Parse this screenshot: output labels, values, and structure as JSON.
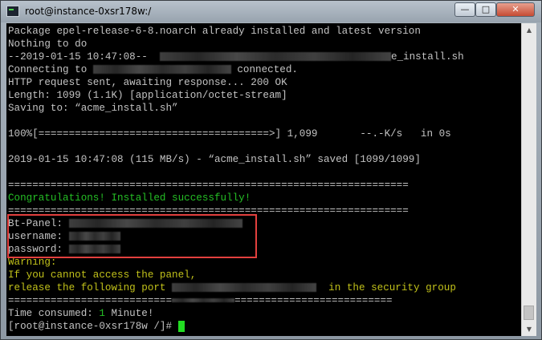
{
  "window": {
    "title": "root@instance-0xsr178w:/",
    "minimize": "—",
    "maximize": "□",
    "close": "✕",
    "icon": "terminal-icon"
  },
  "terminal": {
    "lines": [
      {
        "text": "Package epel-release-6-8.noarch already installed and latest version",
        "color": "#c3c3c3"
      },
      {
        "text": "Nothing to do",
        "color": "#c3c3c3"
      },
      {
        "pre": "--2019-01-15 10:47:08--  ",
        "post": "e_install.sh",
        "color": "#c3c3c3"
      },
      {
        "pre": "Connecting to ",
        "post": " connected.",
        "color": "#c3c3c3"
      },
      {
        "text": "HTTP request sent, awaiting response... 200 OK",
        "color": "#c3c3c3"
      },
      {
        "text": "Length: 1099 (1.1K) [application/octet-stream]",
        "color": "#c3c3c3"
      },
      {
        "text": "Saving to: “acme_install.sh”",
        "color": "#c3c3c3"
      },
      {
        "text": "",
        "color": "#c3c3c3"
      },
      {
        "text": "100%[======================================>] 1,099       --.-K/s   in 0s",
        "color": "#c3c3c3"
      },
      {
        "text": "",
        "color": "#c3c3c3"
      },
      {
        "text": "2019-01-15 10:47:08 (115 MB/s) - “acme_install.sh” saved [1099/1099]",
        "color": "#c3c3c3"
      },
      {
        "text": "",
        "color": "#c3c3c3"
      },
      {
        "text": "==================================================================",
        "color": "#c3c3c3"
      },
      {
        "text": "Congratulations! Installed successfully!",
        "color": "#25bf25"
      },
      {
        "text": "==================================================================",
        "color": "#c3c3c3"
      },
      {
        "pre": "Bt-Panel: ",
        "post": "",
        "color": "#c3c3c3"
      },
      {
        "pre": "username: ",
        "post": "",
        "color": "#c3c3c3"
      },
      {
        "pre": "password: ",
        "post": "",
        "color": "#c3c3c3"
      },
      {
        "text": "Warning:",
        "color": "#c1c11a"
      },
      {
        "text": "If you cannot access the panel,",
        "color": "#c1c11a"
      },
      {
        "pre": "release the following port ",
        "post": "  in the security group",
        "color": "#c1c11a"
      },
      {
        "pre": "===========================",
        "post": "==========================",
        "color": "#c3c3c3"
      },
      {
        "pre": "Time consumed: ",
        "mid": "1",
        "post": " Minute!",
        "color": "#c3c3c3"
      },
      {
        "text": "[root@instance-0xsr178w /]# ",
        "color": "#c3c3c3"
      }
    ]
  },
  "scrollbar": {
    "up_arrow": "▲",
    "down_arrow": "▼"
  }
}
